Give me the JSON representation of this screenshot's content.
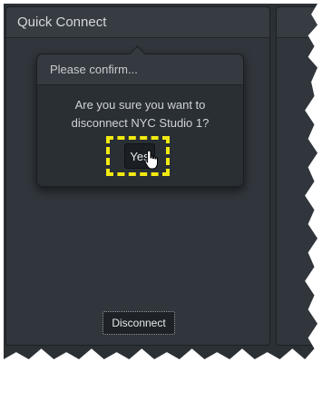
{
  "panel": {
    "title": "Quick Connect"
  },
  "dialog": {
    "title": "Please confirm...",
    "message": "Are you sure you want to disconnect NYC Studio 1?",
    "yes_label": "Yes"
  },
  "footer": {
    "disconnect_label": "Disconnect"
  },
  "colors": {
    "highlight": "#f2ea10",
    "panel_bg": "#31363c"
  },
  "icons": {
    "cursor": "hand-pointer-icon"
  }
}
